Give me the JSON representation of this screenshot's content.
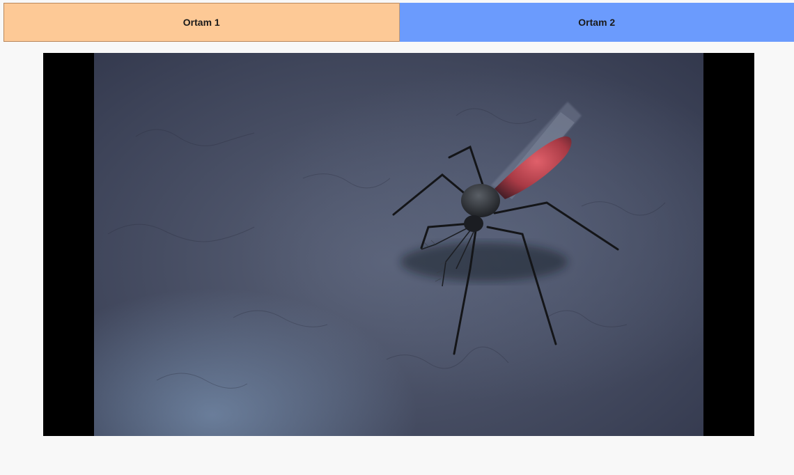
{
  "tabs": [
    {
      "label": "Ortam 1",
      "color": "#fdc996",
      "selected": true
    },
    {
      "label": "Ortam 2",
      "color": "#6b9bfd",
      "selected": false
    }
  ],
  "media": {
    "subject": "mosquito-on-skin-video-frame"
  }
}
